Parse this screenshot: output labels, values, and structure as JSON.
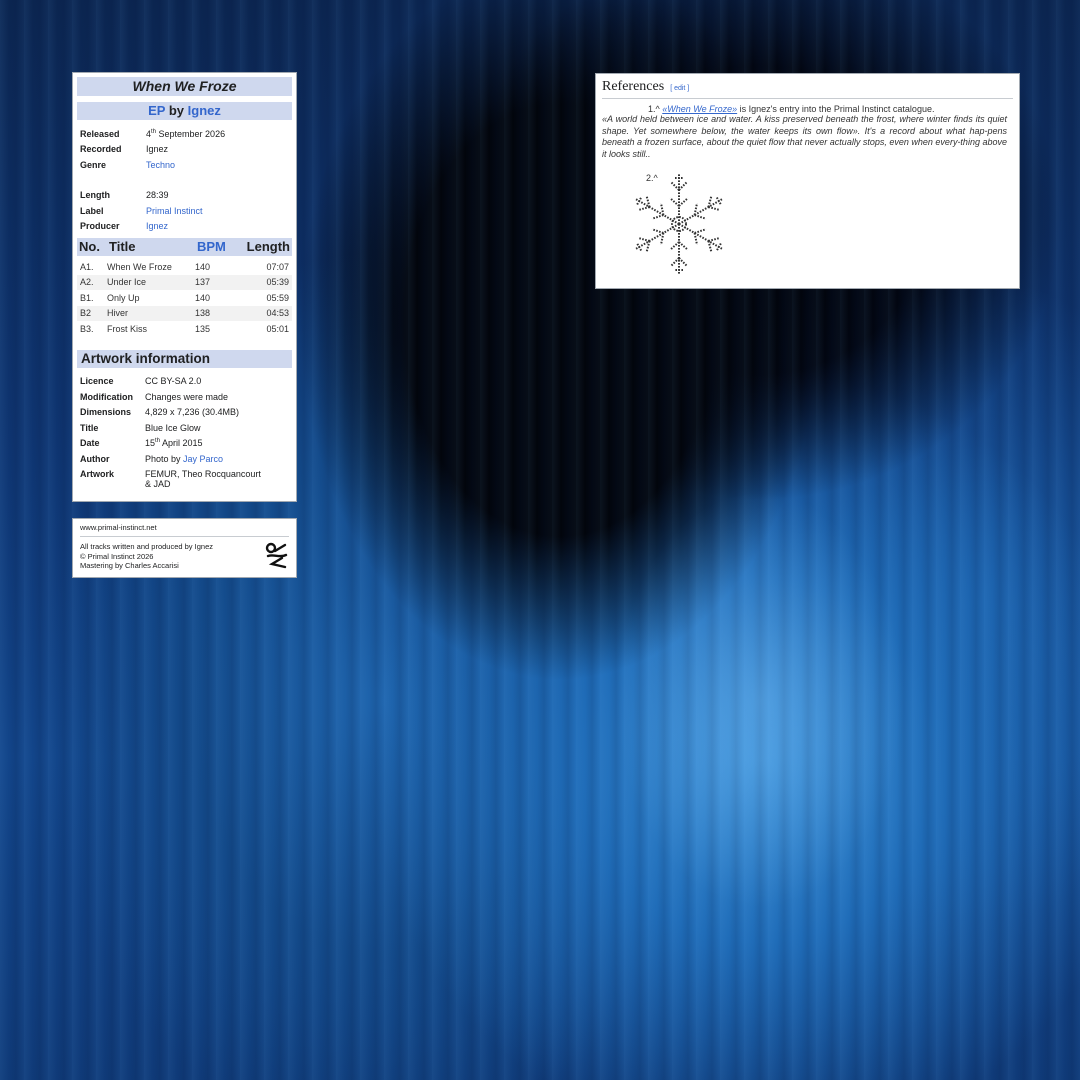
{
  "infobox": {
    "title": "When We Froze",
    "type": "EP",
    "by": "by",
    "artist": "Ignez",
    "details": [
      {
        "key": "Released",
        "value_prefix": "4",
        "value_sup": "th",
        "value_rest": " September 2026",
        "link": false
      },
      {
        "key": "Recorded",
        "value": "Ignez",
        "link": false
      },
      {
        "key": "Genre",
        "value": "Techno",
        "link": true
      },
      {
        "key": "Length",
        "value": "28:39",
        "link": false
      },
      {
        "key": "Label",
        "value": "Primal Instinct",
        "link": true
      },
      {
        "key": "Producer",
        "value": "Ignez",
        "link": true
      }
    ]
  },
  "tracklist": {
    "headers": {
      "no": "No.",
      "title": "Title",
      "bpm": "BPM",
      "length": "Length"
    },
    "tracks": [
      {
        "no": "A1.",
        "title": "When We Froze",
        "bpm": "140",
        "length": "07:07"
      },
      {
        "no": "A2.",
        "title": "Under Ice",
        "bpm": "137",
        "length": "05:39"
      },
      {
        "no": "B1.",
        "title": "Only Up",
        "bpm": "140",
        "length": "05:59"
      },
      {
        "no": "B2",
        "title": "Hiver",
        "bpm": "138",
        "length": "04:53"
      },
      {
        "no": "B3.",
        "title": "Frost Kiss",
        "bpm": "135",
        "length": "05:01"
      }
    ]
  },
  "artwork": {
    "heading": "Artwork information",
    "licence_key": "Licence",
    "licence": "CC BY-SA 2.0",
    "modification_key": "Modification",
    "modification": "Changes were made",
    "dimensions_key": "Dimensions",
    "dimensions": "4,829 x 7,236 (30.4MB)",
    "title_key": "Title",
    "title": "Blue Ice Glow",
    "date_key": "Date",
    "date_prefix": "15",
    "date_sup": "th",
    "date_rest": " April 2015",
    "author_key": "Author",
    "author_prefix": "Photo by ",
    "author_link": "Jay Parco",
    "artwork_key": "Artwork",
    "artwork_line1": "FEMUR, Theo Rocquancourt",
    "artwork_line2": "& JAD"
  },
  "credits": {
    "url": "www.primal-instinct.net",
    "line1": "All tracks written and produced by Ignez",
    "line2": "© Primal Instinct 2026",
    "line3": "Mastering by Charles Accarisi"
  },
  "references": {
    "title": "References",
    "edit": "[ edit ]",
    "ref1_marker": "1.^",
    "ref1_link": "«When We Froze»",
    "ref1_text": " is Ignez's entry into the Primal Instinct catalogue.",
    "quote": "«A world held between ice and water. A kiss preserved beneath the frost, where winter finds its quiet shape. Yet somewhere below, the water keeps its own flow». It's a record about what hap-pens beneath a frozen surface, about the quiet flow that never actually stops, even when every-thing above it looks still..",
    "ref2_marker": "2.^"
  },
  "colors": {
    "accent": "#3366cc",
    "header_bg": "#cfd8ee"
  }
}
